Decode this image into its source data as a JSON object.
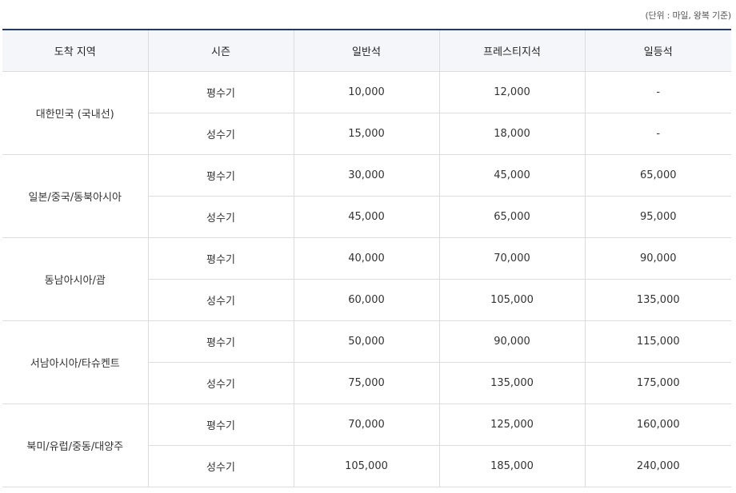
{
  "unit_note": "(단위 : 마일, 왕복 기준)",
  "headers": [
    "도착 지역",
    "시즌",
    "일반석",
    "프레스티지석",
    "일등석"
  ],
  "regions": [
    {
      "name": "대한민국 (국내선)",
      "rows": [
        {
          "season": "평수기",
          "economy": "10,000",
          "prestige": "12,000",
          "first": "-"
        },
        {
          "season": "성수기",
          "economy": "15,000",
          "prestige": "18,000",
          "first": "-"
        }
      ]
    },
    {
      "name": "일본/중국/동북아시아",
      "rows": [
        {
          "season": "평수기",
          "economy": "30,000",
          "prestige": "45,000",
          "first": "65,000"
        },
        {
          "season": "성수기",
          "economy": "45,000",
          "prestige": "65,000",
          "first": "95,000"
        }
      ]
    },
    {
      "name": "동남아시아/괌",
      "rows": [
        {
          "season": "평수기",
          "economy": "40,000",
          "prestige": "70,000",
          "first": "90,000"
        },
        {
          "season": "성수기",
          "economy": "60,000",
          "prestige": "105,000",
          "first": "135,000"
        }
      ]
    },
    {
      "name": "서남아시아/타슈켄트",
      "rows": [
        {
          "season": "평수기",
          "economy": "50,000",
          "prestige": "90,000",
          "first": "115,000"
        },
        {
          "season": "성수기",
          "economy": "75,000",
          "prestige": "135,000",
          "first": "175,000"
        }
      ]
    },
    {
      "name": "북미/유럽/중동/대양주",
      "rows": [
        {
          "season": "평수기",
          "economy": "70,000",
          "prestige": "125,000",
          "first": "160,000"
        },
        {
          "season": "성수기",
          "economy": "105,000",
          "prestige": "185,000",
          "first": "240,000"
        }
      ]
    }
  ]
}
